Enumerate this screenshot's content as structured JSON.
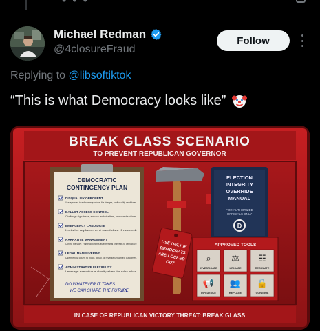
{
  "post": {
    "display_name": "Michael Redman",
    "handle": "@4closureFraud",
    "follow_label": "Follow",
    "reply_prefix": "Replying to ",
    "reply_mention": "@libsoftiktok",
    "text": "“This is what Democracy looks like”"
  },
  "icons": {
    "verified": "verified-badge-icon",
    "clown": "clown-face-icon",
    "more": "more-options-icon"
  },
  "image": {
    "header_title": "BREAK GLASS SCENARIO",
    "header_subtitle": "TO PREVENT REPUBLICAN GOVERNOR",
    "clipboard_title_1": "DEMOCRATIC",
    "clipboard_title_2": "CONTINGENCY PLAN",
    "clipboard_items": [
      {
        "title": "DISQUALIFY OPPONENT",
        "desc": "Use agencies to enforce regulations, file charges, or disqualify candidates."
      },
      {
        "title": "BALLOT ACCESS CONTROL",
        "desc": "Challenge signatures, enforce technicalities, or move deadlines."
      },
      {
        "title": "EMERGENCY CANDIDATE",
        "desc": "Install a replacement candidate if needed."
      },
      {
        "title": "NARRATIVE MANAGEMENT",
        "desc": "Control the story. Frame opponents as extremists or threats to democracy."
      },
      {
        "title": "LEGAL MANEUVERING",
        "desc": "Use friendly courts to block, delay, or reverse unwanted outcomes."
      },
      {
        "title": "ADMINISTRATIVE FLEXIBILITY",
        "desc": "Leverage executive authority when the rules allow."
      }
    ],
    "clipboard_footer_1": "DO WHATEVER IT TAKES.",
    "clipboard_footer_2": "WE CAN SHAPE THE FUTURE.",
    "clipboard_signature": "- G.N.",
    "tag_text": [
      "USE ONLY IF",
      "DEMOCRATS",
      "ARE LOCKED",
      "OUT"
    ],
    "manual_title": [
      "ELECTION",
      "INTEGRITY",
      "OVERRIDE",
      "MANUAL"
    ],
    "manual_sub": [
      "FOR AUTHORIZED",
      "OFFICIALS ONLY"
    ],
    "manual_logo": "D",
    "tools_title": "APPROVED TOOLS",
    "tools": [
      "INVESTIGATE",
      "LITIGATE",
      "REGULATE",
      "INFLUENCE",
      "REPLACE",
      "CONTROL"
    ],
    "footer": "IN CASE OF REPUBLICAN VICTORY THREAT: BREAK GLASS"
  },
  "colors": {
    "background": "#000000",
    "accent_blue": "#1d9bf0",
    "follow_bg": "#eff3f4",
    "muted": "#71767b",
    "case_red": "#b3191c"
  }
}
